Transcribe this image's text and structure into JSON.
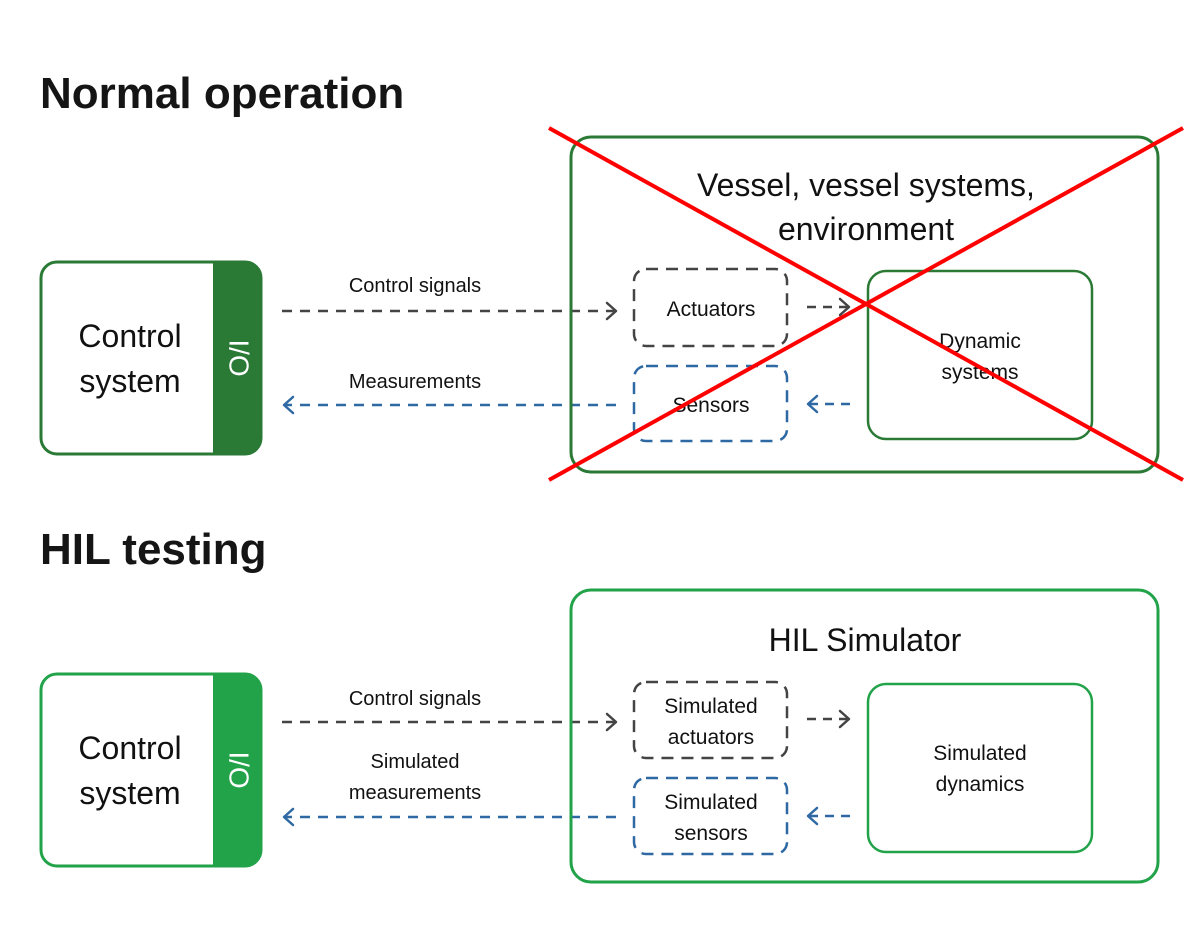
{
  "colors": {
    "normal_green": "#2a7a36",
    "hil_green": "#22a34a",
    "gray_dash": "#444444",
    "blue_dash": "#2f69a3",
    "cross_red": "#ff0000"
  },
  "normal": {
    "heading": "Normal operation",
    "control_system": {
      "line1": "Control",
      "line2": "system",
      "io_label": "I/O"
    },
    "control_signals_label": "Control signals",
    "measurements_label": "Measurements",
    "environment_box": {
      "title_line1": "Vessel, vessel systems,",
      "title_line2": "environment",
      "crossed_out": true
    },
    "actuators_label": "Actuators",
    "sensors_label": "Sensors",
    "dynamics": {
      "line1": "Dynamic",
      "line2": "systems"
    }
  },
  "hil": {
    "heading": "HIL testing",
    "control_system": {
      "line1": "Control",
      "line2": "system",
      "io_label": "I/O"
    },
    "control_signals_label": "Control signals",
    "measurements_label": {
      "line1": "Simulated",
      "line2": "measurements"
    },
    "simulator_box": {
      "title": "HIL Simulator"
    },
    "actuators": {
      "line1": "Simulated",
      "line2": "actuators"
    },
    "sensors": {
      "line1": "Simulated",
      "line2": "sensors"
    },
    "dynamics": {
      "line1": "Simulated",
      "line2": "dynamics"
    }
  }
}
